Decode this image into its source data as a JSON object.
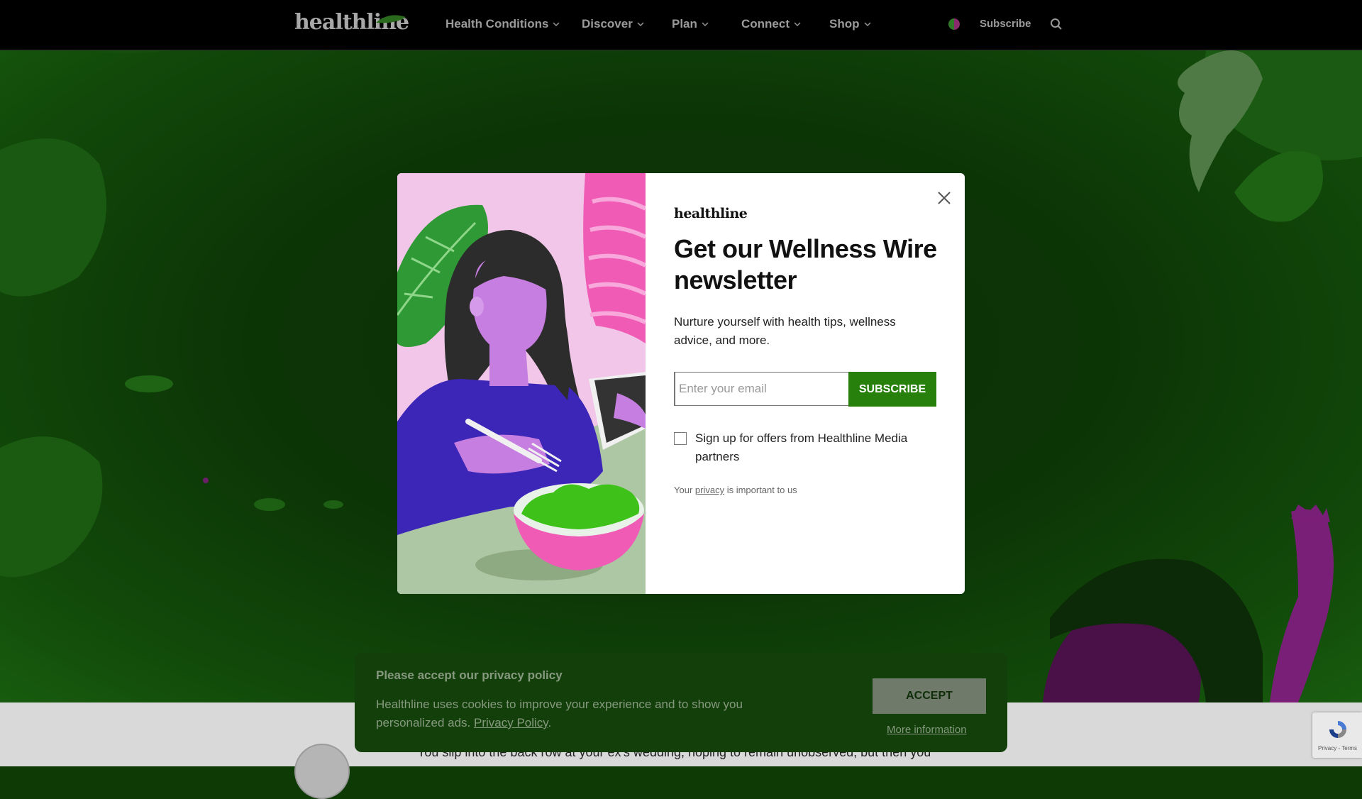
{
  "header": {
    "logo": "healthline",
    "nav": [
      {
        "label": "Health Conditions"
      },
      {
        "label": "Discover"
      },
      {
        "label": "Plan"
      },
      {
        "label": "Connect"
      },
      {
        "label": "Shop"
      }
    ],
    "subscribe_label": "Subscribe"
  },
  "modal": {
    "logo": "healthline",
    "title": "Get our Wellness Wire newsletter",
    "description": "Nurture yourself with health tips, wellness advice, and more.",
    "email_placeholder": "Enter your email",
    "subscribe_button": "SUBSCRIBE",
    "checkbox_label": "Sign up for offers from Healthline Media partners",
    "privacy_prefix": "Your ",
    "privacy_link": "privacy",
    "privacy_suffix": " is important to us"
  },
  "cookie_banner": {
    "title": "Please accept our privacy policy",
    "text": "Healthline uses cookies to improve your experience and to show you personalized ads. ",
    "policy_link": "Privacy Policy",
    "period": ".",
    "accept_button": "ACCEPT",
    "more_info": "More information"
  },
  "article": {
    "lede": "You slip into the back row at your ex's wedding, hoping to remain unobserved, but then you"
  },
  "recaptcha": {
    "text": "Privacy - Terms"
  },
  "colors": {
    "brand_green": "#27800b",
    "overlay_green": "#0e3a06",
    "illustration_pink": "#f2c6e8"
  }
}
